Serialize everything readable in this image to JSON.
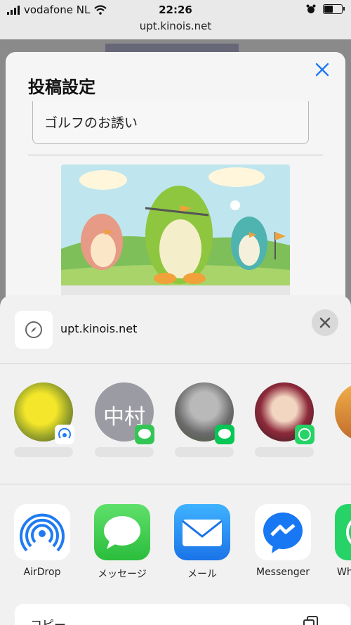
{
  "status_bar": {
    "carrier": "vodafone NL",
    "time": "22:26",
    "url": "upt.kinois.net",
    "battery_level": 0.45
  },
  "modal": {
    "title": "投稿設定",
    "input_value": "ゴルフのお誘い"
  },
  "share_sheet": {
    "site_url": "upt.kinois.net",
    "people": [
      {
        "avatar_text": "",
        "badge": "airdrop-icon"
      },
      {
        "avatar_text": "中村",
        "badge": "messages-icon"
      },
      {
        "avatar_text": "",
        "badge": "line-icon"
      },
      {
        "avatar_text": "",
        "badge": "whatsapp-icon"
      }
    ],
    "apps": [
      {
        "label": "AirDrop",
        "icon": "airdrop-icon"
      },
      {
        "label": "メッセージ",
        "icon": "messages-icon"
      },
      {
        "label": "メール",
        "icon": "mail-icon"
      },
      {
        "label": "Messenger",
        "icon": "messenger-icon"
      },
      {
        "label": "Wh",
        "icon": "whatsapp-icon"
      }
    ],
    "copy_label": "コピー"
  },
  "colors": {
    "accent_blue": "#1f7bf2",
    "messages_green": "#33c655",
    "line_green": "#06c755",
    "whatsapp_green": "#25d366"
  }
}
